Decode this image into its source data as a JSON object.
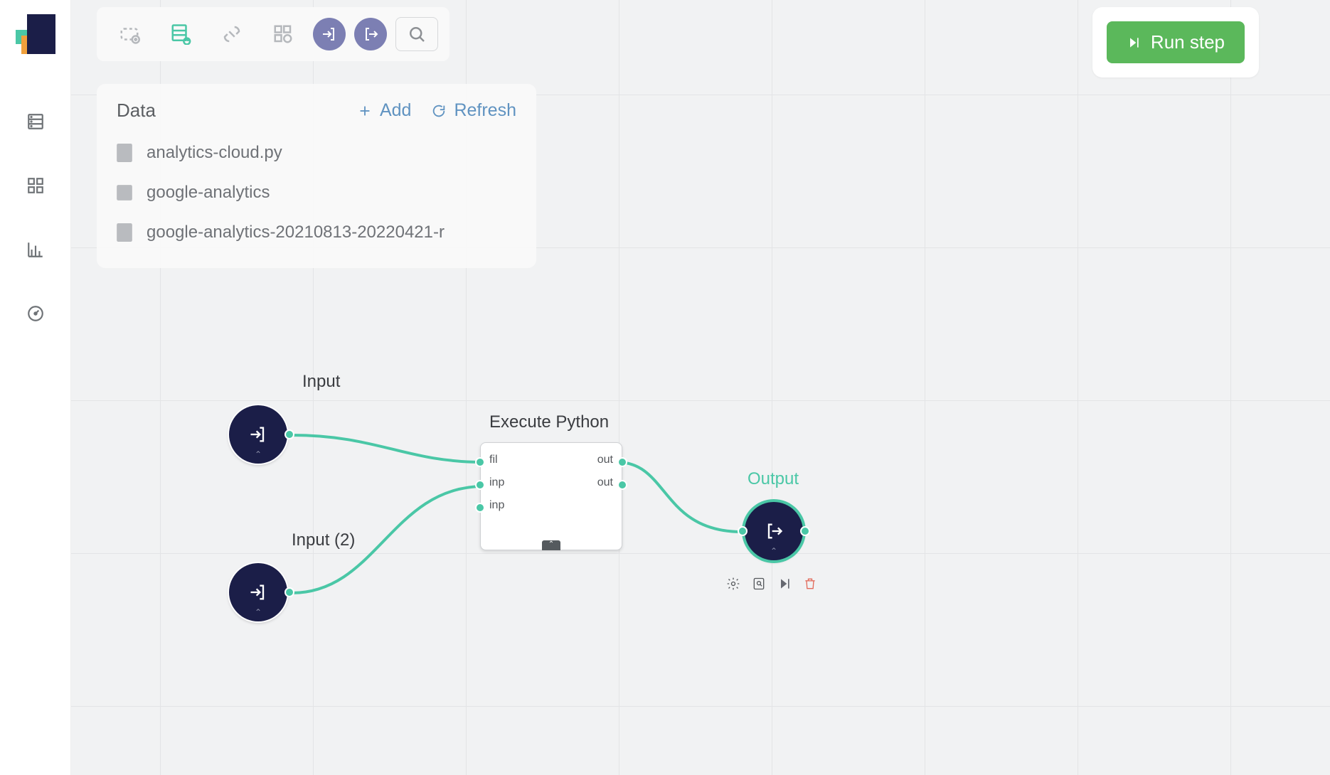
{
  "run_button": "Run step",
  "data_panel": {
    "title": "Data",
    "add": "Add",
    "refresh": "Refresh",
    "files": [
      {
        "icon": "file",
        "name": "analytics-cloud.py"
      },
      {
        "icon": "grid",
        "name": "google-analytics"
      },
      {
        "icon": "csv",
        "name": "google-analytics-20210813-20220421-r"
      }
    ]
  },
  "nodes": {
    "input1": {
      "label": "Input"
    },
    "input2": {
      "label": "Input (2)"
    },
    "execute": {
      "label": "Execute Python",
      "in": [
        "fil",
        "inp",
        "inp"
      ],
      "out": [
        "out",
        "out"
      ]
    },
    "output": {
      "label": "Output"
    }
  }
}
